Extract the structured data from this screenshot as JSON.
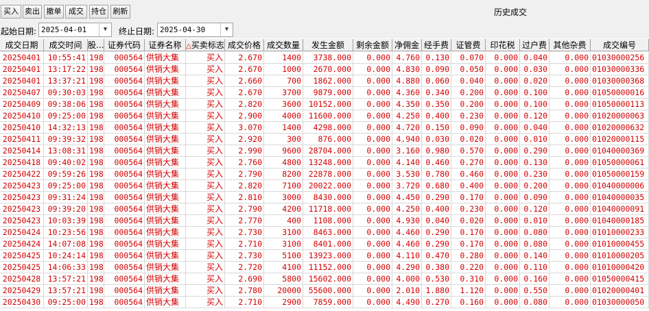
{
  "toolbar": {
    "buttons": [
      "买入",
      "卖出",
      "撤单",
      "成交",
      "持仓",
      "刷新"
    ],
    "title": "历史成交"
  },
  "filter": {
    "start_label": "起始日期:",
    "start_value": "2025-04-01",
    "end_label": "终止日期:",
    "end_value": "2025-04-30",
    "dropdown_icon": "chevron-down-icon"
  },
  "colors": {
    "row_text": "#d40000",
    "header_bg": "#f0f0f0"
  },
  "columns": [
    "成交日期",
    "成交时间",
    "股...",
    "证券代码",
    "证券名称",
    "买卖标志",
    "成交价格",
    "成交数量",
    "发生金额",
    "剩余金额",
    "净佣金",
    "经手费",
    "证管费",
    "印花税",
    "过户费",
    "其他杂费",
    "成交编号"
  ],
  "sort_indicator": "△",
  "rows": [
    [
      "20250401",
      "10:55:41",
      "198",
      "000564",
      "供销大集",
      "买入",
      "2.670",
      "1400",
      "3738.000",
      "0.000",
      "4.760",
      "0.130",
      "0.070",
      "0.000",
      "0.040",
      "0.000",
      "01030000256"
    ],
    [
      "20250401",
      "13:17:22",
      "198",
      "000564",
      "供销大集",
      "买入",
      "2.670",
      "1000",
      "2670.000",
      "0.000",
      "4.830",
      "0.090",
      "0.050",
      "0.000",
      "0.030",
      "0.000",
      "01030000336"
    ],
    [
      "20250401",
      "13:37:21",
      "198",
      "000564",
      "供销大集",
      "买入",
      "2.660",
      "700",
      "1862.000",
      "0.000",
      "4.880",
      "0.060",
      "0.040",
      "0.000",
      "0.020",
      "0.000",
      "01030000368"
    ],
    [
      "20250407",
      "09:30:03",
      "198",
      "000564",
      "供销大集",
      "买入",
      "2.670",
      "3700",
      "9879.000",
      "0.000",
      "4.360",
      "0.340",
      "0.200",
      "0.000",
      "0.100",
      "0.000",
      "01050000016"
    ],
    [
      "20250409",
      "09:38:06",
      "198",
      "000564",
      "供销大集",
      "买入",
      "2.820",
      "3600",
      "10152.000",
      "0.000",
      "4.350",
      "0.350",
      "0.200",
      "0.000",
      "0.100",
      "0.000",
      "01050000113"
    ],
    [
      "20250410",
      "09:25:00",
      "198",
      "000564",
      "供销大集",
      "买入",
      "2.900",
      "4000",
      "11600.000",
      "0.000",
      "4.250",
      "0.400",
      "0.230",
      "0.000",
      "0.120",
      "0.000",
      "01020000063"
    ],
    [
      "20250410",
      "14:32:13",
      "198",
      "000564",
      "供销大集",
      "买入",
      "3.070",
      "1400",
      "4298.000",
      "0.000",
      "4.720",
      "0.150",
      "0.090",
      "0.000",
      "0.040",
      "0.000",
      "01020000632"
    ],
    [
      "20250411",
      "09:39:32",
      "198",
      "000564",
      "供销大集",
      "买入",
      "2.920",
      "300",
      "876.000",
      "0.000",
      "4.940",
      "0.030",
      "0.020",
      "0.000",
      "0.010",
      "0.000",
      "01020000115"
    ],
    [
      "20250414",
      "13:08:31",
      "198",
      "000564",
      "供销大集",
      "买入",
      "2.990",
      "9600",
      "28704.000",
      "0.000",
      "3.160",
      "0.980",
      "0.570",
      "0.000",
      "0.290",
      "0.000",
      "01040000369"
    ],
    [
      "20250418",
      "09:40:02",
      "198",
      "000564",
      "供销大集",
      "买入",
      "2.760",
      "4800",
      "13248.000",
      "0.000",
      "4.140",
      "0.460",
      "0.270",
      "0.000",
      "0.130",
      "0.000",
      "01050000061"
    ],
    [
      "20250422",
      "09:59:26",
      "198",
      "000564",
      "供销大集",
      "买入",
      "2.790",
      "8200",
      "22878.000",
      "0.000",
      "3.530",
      "0.780",
      "0.460",
      "0.000",
      "0.230",
      "0.000",
      "01050000159"
    ],
    [
      "20250423",
      "09:25:00",
      "198",
      "000564",
      "供销大集",
      "买入",
      "2.820",
      "7100",
      "20022.000",
      "0.000",
      "3.720",
      "0.680",
      "0.400",
      "0.000",
      "0.200",
      "0.000",
      "01040000006"
    ],
    [
      "20250423",
      "09:31:24",
      "198",
      "000564",
      "供销大集",
      "买入",
      "2.810",
      "3000",
      "8430.000",
      "0.000",
      "4.450",
      "0.290",
      "0.170",
      "0.000",
      "0.090",
      "0.000",
      "01040000035"
    ],
    [
      "20250423",
      "09:39:20",
      "198",
      "000564",
      "供销大集",
      "买入",
      "2.790",
      "4200",
      "11718.000",
      "0.000",
      "4.250",
      "0.400",
      "0.230",
      "0.000",
      "0.120",
      "0.000",
      "01040000091"
    ],
    [
      "20250423",
      "10:03:39",
      "198",
      "000564",
      "供销大集",
      "买入",
      "2.770",
      "400",
      "1108.000",
      "0.000",
      "4.930",
      "0.040",
      "0.020",
      "0.000",
      "0.010",
      "0.000",
      "01040000185"
    ],
    [
      "20250424",
      "10:23:56",
      "198",
      "000564",
      "供销大集",
      "买入",
      "2.730",
      "3100",
      "8463.000",
      "0.000",
      "4.460",
      "0.290",
      "0.170",
      "0.000",
      "0.080",
      "0.000",
      "01010000233"
    ],
    [
      "20250424",
      "14:07:08",
      "198",
      "000564",
      "供销大集",
      "买入",
      "2.710",
      "3100",
      "8401.000",
      "0.000",
      "4.460",
      "0.290",
      "0.170",
      "0.000",
      "0.080",
      "0.000",
      "01010000455"
    ],
    [
      "20250425",
      "10:24:14",
      "198",
      "000564",
      "供销大集",
      "买入",
      "2.730",
      "5100",
      "13923.000",
      "0.000",
      "4.110",
      "0.470",
      "0.280",
      "0.000",
      "0.140",
      "0.000",
      "01010000205"
    ],
    [
      "20250425",
      "14:06:33",
      "198",
      "000564",
      "供销大集",
      "买入",
      "2.720",
      "4100",
      "11152.000",
      "0.000",
      "4.290",
      "0.380",
      "0.220",
      "0.000",
      "0.110",
      "0.000",
      "01010000420"
    ],
    [
      "20250428",
      "13:57:21",
      "198",
      "000564",
      "供销大集",
      "买入",
      "2.690",
      "5800",
      "15602.000",
      "0.000",
      "4.000",
      "0.530",
      "0.310",
      "0.000",
      "0.160",
      "0.000",
      "01050000415"
    ],
    [
      "20250429",
      "13:57:21",
      "198",
      "000564",
      "供销大集",
      "买入",
      "2.780",
      "20000",
      "55600.000",
      "0.000",
      "2.010",
      "1.880",
      "1.120",
      "0.000",
      "0.550",
      "0.000",
      "01020000401"
    ],
    [
      "20250430",
      "09:25:00",
      "198",
      "000564",
      "供销大集",
      "买入",
      "2.710",
      "2900",
      "7859.000",
      "0.000",
      "4.490",
      "0.270",
      "0.160",
      "0.000",
      "0.080",
      "0.000",
      "01030000050"
    ]
  ]
}
